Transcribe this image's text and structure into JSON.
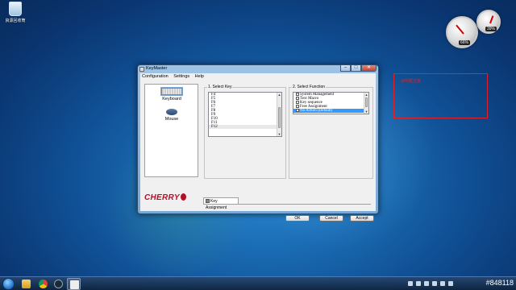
{
  "desktop": {
    "recycle_bin_label": "資源回收筒",
    "gadget_cpu": "66%",
    "gadget_ram": "39%"
  },
  "window": {
    "title": "KeyMaster",
    "menu": [
      "Configuration",
      "Settings",
      "Help"
    ],
    "devices": [
      {
        "label": "Keyboard",
        "icon": "keyboard-icon"
      },
      {
        "label": "Mouse",
        "icon": "mouse-icon"
      }
    ],
    "select_key": {
      "label": "1. Select Key",
      "items": [
        "F4",
        "F5",
        "F6",
        "F7",
        "F8",
        "F9",
        "F10",
        "F11",
        "F12"
      ],
      "selected": "F12"
    },
    "select_function": {
      "label": "2. Select Function",
      "items": [
        "System Management",
        "Text Macro",
        "Key sequence",
        "Free Assignment",
        "No Action (Default)"
      ],
      "selected": "No Action (Default)"
    },
    "tab_label": "Key Assignment",
    "logo_text": "CHERRY",
    "buttons": {
      "ok": "OK",
      "cancel": "Cancel",
      "accept": "Accept"
    }
  },
  "annotation": {
    "text": "說明框位置"
  },
  "taskbar": {
    "clock": "#848118"
  }
}
